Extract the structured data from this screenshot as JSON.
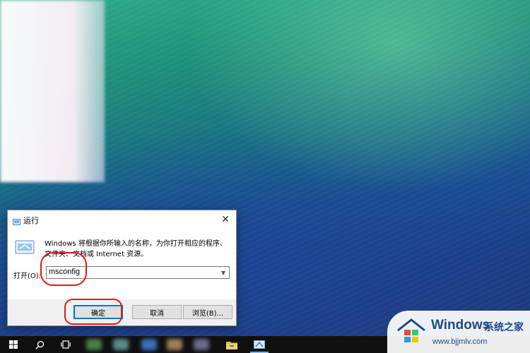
{
  "dialog": {
    "title": "运行",
    "description": "Windows 将根据你所输入的名称，为你打开相应的程序、文件夹、文档或 Internet 资源。",
    "open_label": "打开(O):",
    "open_value": "msconfig",
    "buttons": {
      "ok": "确定",
      "cancel": "取消",
      "browse": "浏览(B)..."
    }
  },
  "annotations": {
    "color": "#e01818"
  },
  "taskbar": {
    "items": [
      "windows-start-icon",
      "search-icon",
      "task-view-icon",
      "file-explorer-icon",
      "run-app-icon"
    ]
  },
  "watermark": {
    "brand": "Windows",
    "brand_cn": "系统之家",
    "url": "www.bjjmlv.com"
  },
  "colors": {
    "accent": "#0078d7",
    "annotation": "#e01818",
    "watermark_text": "#1e4a8a"
  }
}
